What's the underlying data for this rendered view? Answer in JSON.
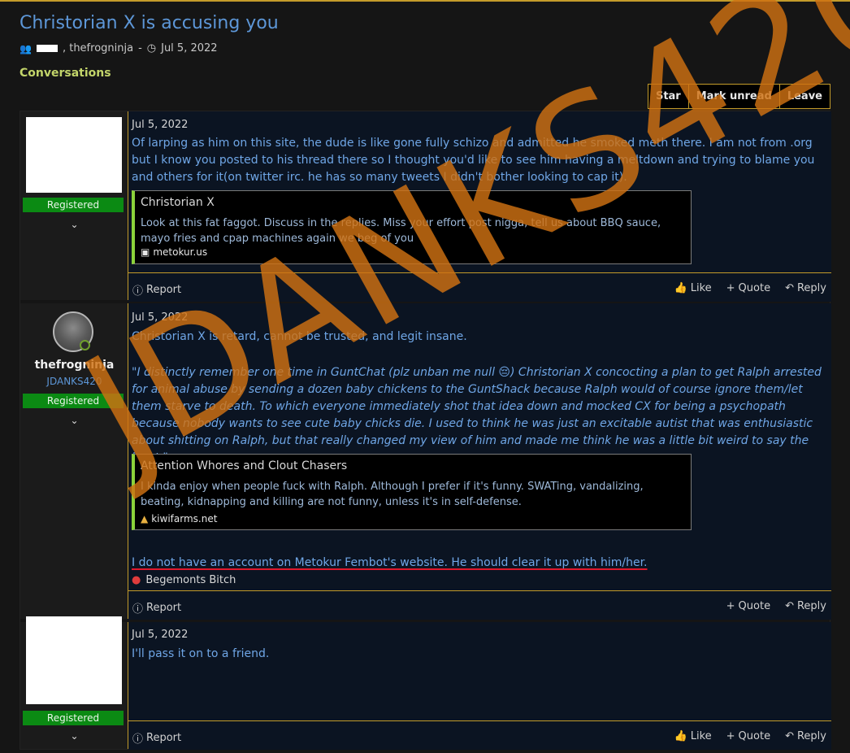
{
  "header": {
    "title": "Christorian X is accusing you",
    "participants": ", thefrogninja",
    "date": "Jul 5, 2022",
    "breadcrumb": "Conversations"
  },
  "toolbar": {
    "star": "Star",
    "mark_unread": "Mark unread",
    "leave": "Leave"
  },
  "messages": [
    {
      "user_badge": "Registered",
      "date": "Jul 5, 2022",
      "text": "Of larping as him on this site, the dude is like gone fully schizo and admitted he smoked meth there. I am not from .org but I know you posted to his thread there so I thought you'd like to see him having a meltdown and trying to blame you and others for it(on twitter irc. he has so many tweets I didn't bother looking to cap it).",
      "quote": {
        "title": "Christorian X",
        "text": "Look at this fat faggot. Discuss in the replies. Miss your effort post nigga, tell us about BBQ sauce, mayo fries and cpap machines again we beg of you",
        "source": "metokur.us"
      },
      "report": "Report",
      "like": "Like",
      "quote_btn": "Quote",
      "reply": "Reply"
    },
    {
      "username": "thefrogninja",
      "user_title": "JDANKS420",
      "user_badge": "Registered",
      "date": "Jul 5, 2022",
      "text": "Christorian X is retard, cannot be trusted, and legit insane.",
      "italic_text": "\"I distinctly remember one time in GuntChat (plz unban me null 😔) Christorian X concocting a plan to get Ralph arrested for animal abuse by sending a dozen baby chickens to the GuntShack because Ralph would of course ignore them/let them starve to death. To which everyone immediately shot that idea down and mocked CX for being a psychopath because nobody wants to see cute baby chicks die. I used to think he was just an excitable autist that was enthusiastic about shitting on Ralph, but that really changed my view of him and made me think he was a little bit weird to say the least.\"",
      "quote": {
        "title": "Attention Whores and Clout Chasers",
        "text": "I kinda enjoy when people fuck with Ralph. Although I prefer if it's funny. SWATing, vandalizing, beating, kidnapping and killing are not funny, unless it's in self-defense.",
        "source": "kiwifarms.net"
      },
      "underlined_text": "I do not have an account on Metokur Fembot's website. He should clear it up with him/her.",
      "signature": "Begemonts Bitch",
      "report": "Report",
      "quote_btn": "Quote",
      "reply": "Reply"
    },
    {
      "user_badge": "Registered",
      "date": "Jul 5, 2022",
      "text": "I'll pass it on to a friend.",
      "report": "Report",
      "like": "Like",
      "quote_btn": "Quote",
      "reply": "Reply"
    }
  ],
  "watermark": "JDANKS420",
  "colors": {
    "accent": "#c39b2a",
    "link": "#5d97d8",
    "badge": "#0b8a13",
    "watermark": "#d07212"
  }
}
